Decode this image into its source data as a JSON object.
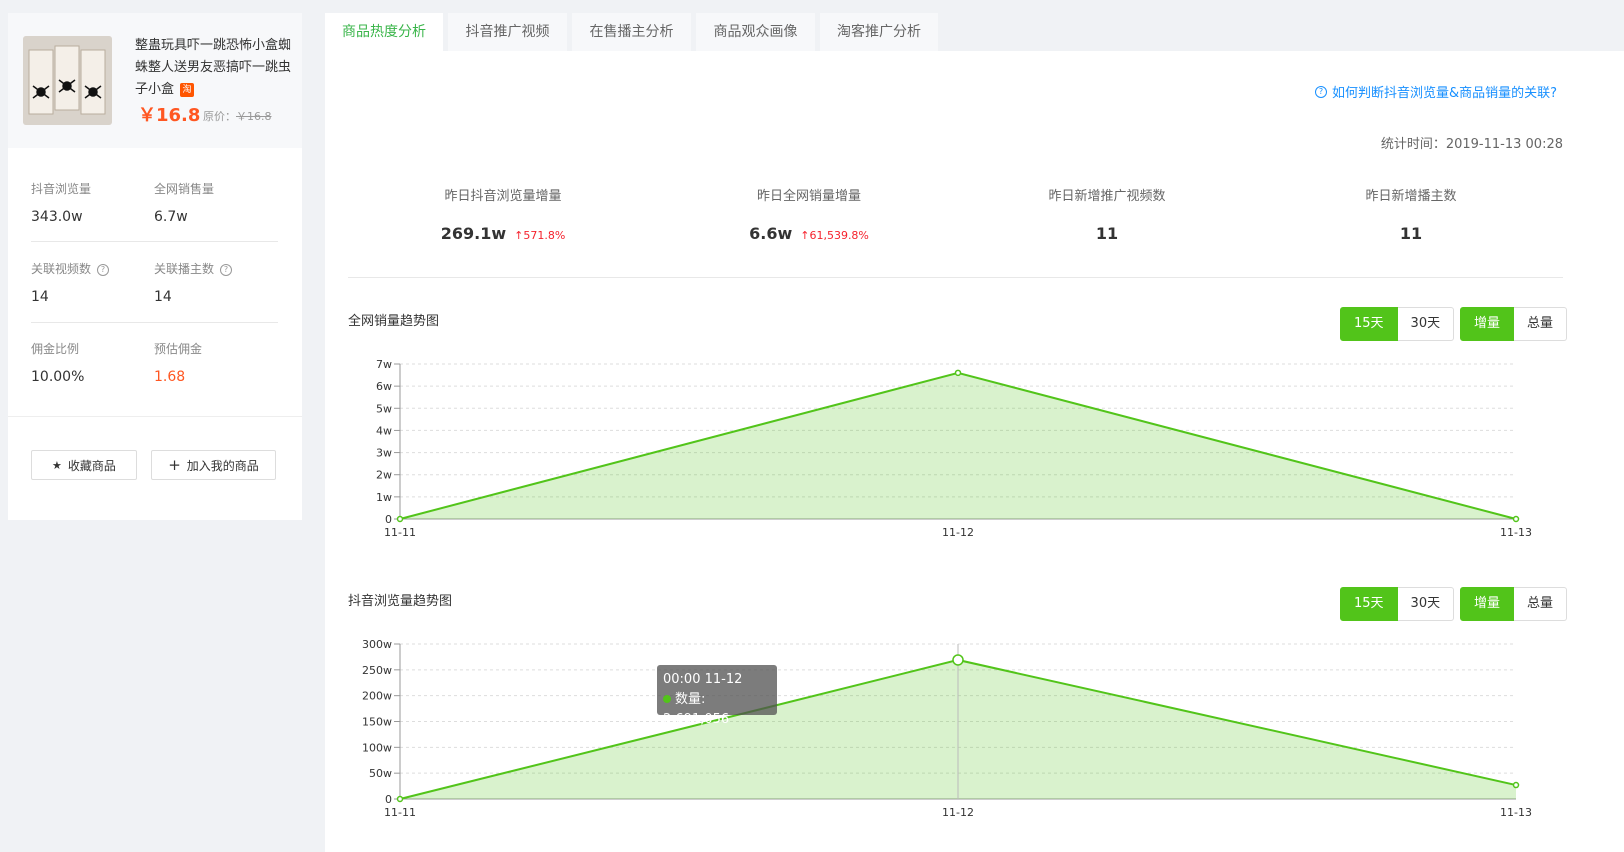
{
  "product": {
    "title": "整蛊玩具吓一跳恐怖小盒蜘蛛整人送男友恶搞吓一跳虫子小盒",
    "platform_badge": "淘",
    "price": "￥16.8",
    "orig_label": "原价：",
    "orig_price": "￥16.8"
  },
  "stats": {
    "views_label": "抖音浏览量",
    "views_value": "343.0w",
    "sales_label": "全网销售量",
    "sales_value": "6.7w",
    "videos_label": "关联视频数",
    "videos_value": "14",
    "anchors_label": "关联播主数",
    "anchors_value": "14",
    "commission_rate_label": "佣金比例",
    "commission_rate_value": "10.00%",
    "est_commission_label": "预估佣金",
    "est_commission_value": "1.68"
  },
  "buttons": {
    "favorite": "收藏商品",
    "add_mine": "加入我的商品"
  },
  "tabs": [
    "商品热度分析",
    "抖音推广视频",
    "在售播主分析",
    "商品观众画像",
    "淘客推广分析"
  ],
  "help_link": "如何判断抖音浏览量&商品销量的关联?",
  "stat_time": "统计时间：2019-11-13 00:28",
  "kpis": [
    {
      "label": "昨日抖音浏览量增量",
      "value": "269.1w",
      "change": "↑571.8%"
    },
    {
      "label": "昨日全网销量增量",
      "value": "6.6w",
      "change": "↑61,539.8%"
    },
    {
      "label": "昨日新增推广视频数",
      "value": "11",
      "change": ""
    },
    {
      "label": "昨日新增播主数",
      "value": "11",
      "change": ""
    }
  ],
  "controls": {
    "d15": "15天",
    "d30": "30天",
    "inc": "增量",
    "total": "总量"
  },
  "accent_color": "#52c41a",
  "chart_data": [
    {
      "type": "area",
      "title": "全网销量趋势图",
      "x": [
        "11-11",
        "11-12",
        "11-13"
      ],
      "series": [
        {
          "values": [
            0,
            66000,
            0
          ]
        }
      ],
      "yticks": [
        "0",
        "1w",
        "2w",
        "3w",
        "4w",
        "5w",
        "6w",
        "7w"
      ],
      "ylim": [
        0,
        70000
      ],
      "grid": true
    },
    {
      "type": "area",
      "title": "抖音浏览量趋势图",
      "x": [
        "11-11",
        "11-12",
        "11-13"
      ],
      "series": [
        {
          "name": "数量",
          "values": [
            0,
            2691056,
            270000
          ]
        }
      ],
      "yticks": [
        "0",
        "50w",
        "100w",
        "150w",
        "200w",
        "250w",
        "300w"
      ],
      "ylim": [
        0,
        3000000
      ],
      "grid": true,
      "tooltip": {
        "time": "00:00 11-12",
        "label": "数量: 2,691,056"
      }
    }
  ]
}
